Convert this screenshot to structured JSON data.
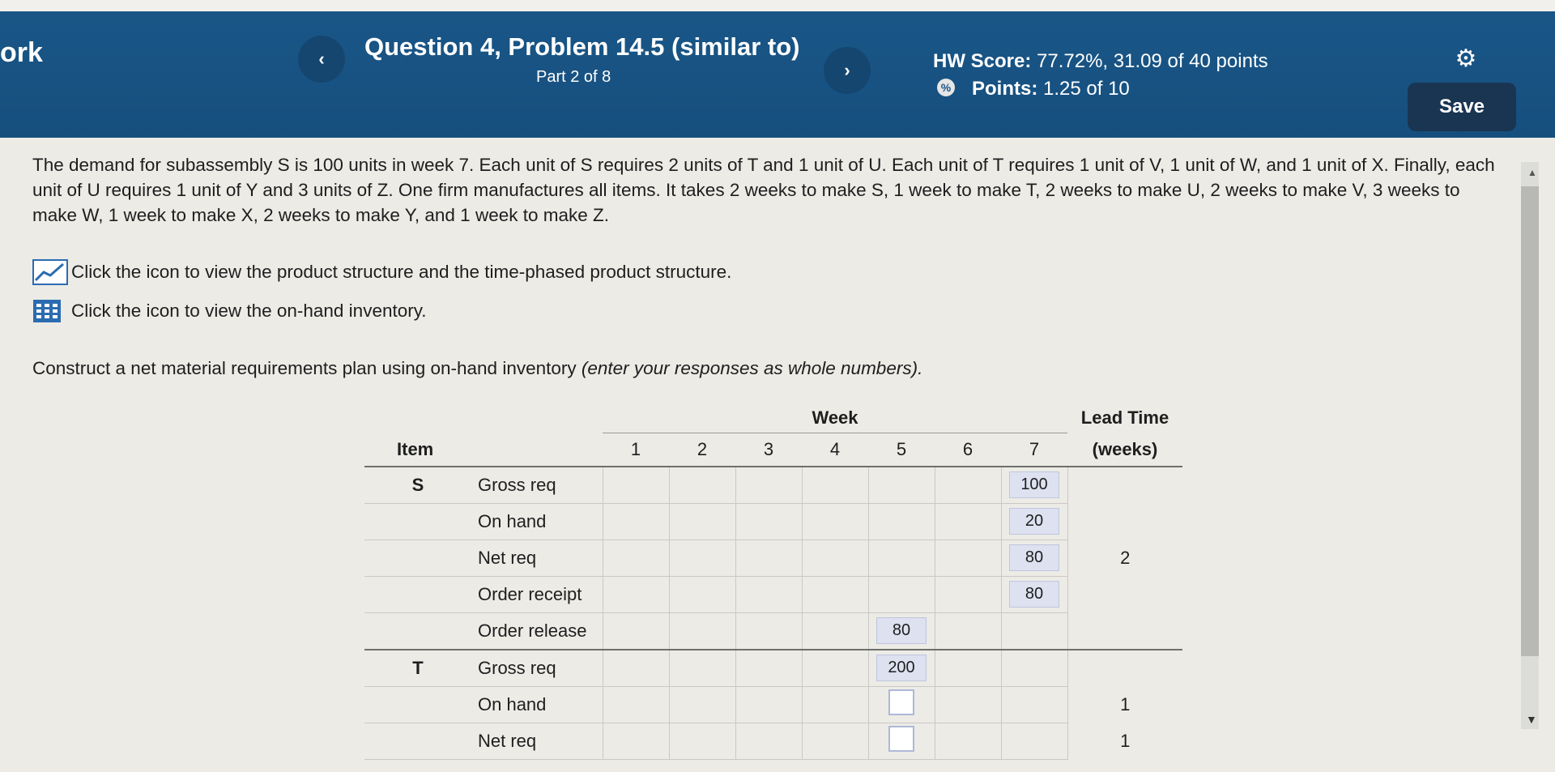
{
  "header": {
    "app_title": "ork",
    "question_title": "Question 4, Problem 14.5 (similar to)",
    "part": "Part 2 of 8",
    "hw_score_label": "HW Score:",
    "hw_score_value": "77.72%, 31.09 of 40 points",
    "points_label": "Points:",
    "points_value": "1.25 of 10",
    "save_label": "Save",
    "prev_glyph": "‹",
    "next_glyph": "›"
  },
  "problem": {
    "text": "The demand for subassembly S is 100 units in week 7. Each unit of S requires 2 units of T and 1 unit of U. Each unit of T requires 1 unit of V, 1 unit of W, and 1 unit of X. Finally, each unit of U requires 1 unit of Y and 3 units of Z. One firm manufactures all items. It takes 2 weeks to make S, 1 week to make T, 2 weeks to make U, 2 weeks to make V, 3 weeks to make W, 1 week to make X, 2 weeks to make Y, and 1 week to make Z.",
    "instruction_1": "Click the icon to view the product structure and the time-phased product structure.",
    "instruction_2": "Click the icon to view the on-hand inventory.",
    "construct_plain": "Construct a net material requirements plan using on-hand inventory ",
    "construct_italic": "(enter your responses as whole numbers)."
  },
  "table": {
    "week_header": "Week",
    "item_header": "Item",
    "lead_time_header": "Lead Time",
    "lead_time_unit": "(weeks)",
    "weeks": [
      "1",
      "2",
      "3",
      "4",
      "5",
      "6",
      "7"
    ],
    "items": [
      {
        "name": "S",
        "lead_time": "2",
        "rows": [
          {
            "label": "Gross req",
            "values": [
              "",
              "",
              "",
              "",
              "",
              "",
              "100"
            ]
          },
          {
            "label": "On hand",
            "values": [
              "",
              "",
              "",
              "",
              "",
              "",
              "20"
            ]
          },
          {
            "label": "Net req",
            "values": [
              "",
              "",
              "",
              "",
              "",
              "",
              "80"
            ]
          },
          {
            "label": "Order receipt",
            "values": [
              "",
              "",
              "",
              "",
              "",
              "",
              "80"
            ]
          },
          {
            "label": "Order release",
            "values": [
              "",
              "",
              "",
              "",
              "80",
              "",
              ""
            ]
          }
        ]
      },
      {
        "name": "T",
        "lead_time": "1",
        "rows": [
          {
            "label": "Gross req",
            "values": [
              "",
              "",
              "",
              "",
              "200",
              "",
              ""
            ]
          },
          {
            "label": "On hand",
            "values": [
              "",
              "",
              "",
              "",
              "",
              "",
              ""
            ]
          },
          {
            "label": "Net req",
            "values": [
              "",
              "",
              "",
              "",
              "",
              "",
              ""
            ]
          }
        ]
      }
    ]
  },
  "colors": {
    "header_blue": "#1d5486",
    "save_bg": "#1a3552",
    "filled_cell_bg": "#dde1f0"
  },
  "icons": {
    "settings": "gear-icon",
    "chart": "line-chart-icon",
    "table": "table-icon"
  }
}
